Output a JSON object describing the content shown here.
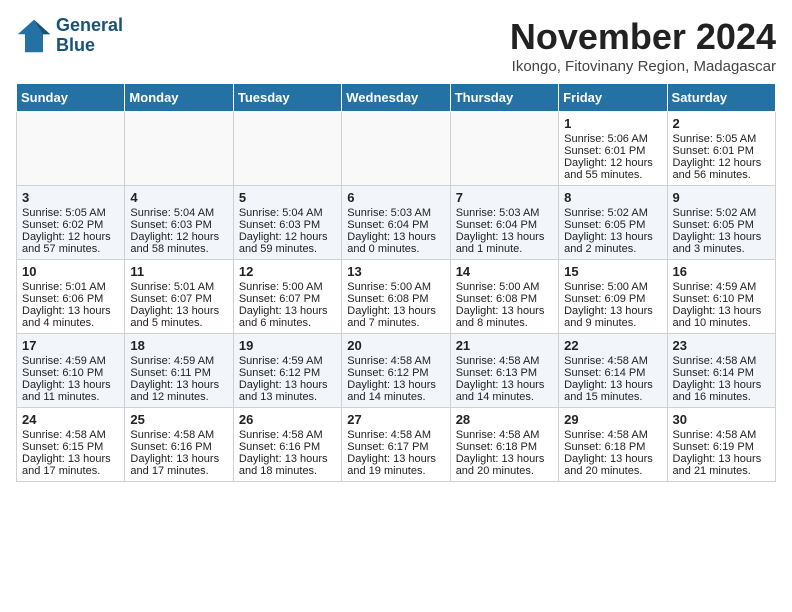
{
  "header": {
    "logo_line1": "General",
    "logo_line2": "Blue",
    "month": "November 2024",
    "location": "Ikongo, Fitovinany Region, Madagascar"
  },
  "weekdays": [
    "Sunday",
    "Monday",
    "Tuesday",
    "Wednesday",
    "Thursday",
    "Friday",
    "Saturday"
  ],
  "weeks": [
    [
      {
        "day": "",
        "sunrise": "",
        "sunset": "",
        "daylight": ""
      },
      {
        "day": "",
        "sunrise": "",
        "sunset": "",
        "daylight": ""
      },
      {
        "day": "",
        "sunrise": "",
        "sunset": "",
        "daylight": ""
      },
      {
        "day": "",
        "sunrise": "",
        "sunset": "",
        "daylight": ""
      },
      {
        "day": "",
        "sunrise": "",
        "sunset": "",
        "daylight": ""
      },
      {
        "day": "1",
        "sunrise": "Sunrise: 5:06 AM",
        "sunset": "Sunset: 6:01 PM",
        "daylight": "Daylight: 12 hours and 55 minutes."
      },
      {
        "day": "2",
        "sunrise": "Sunrise: 5:05 AM",
        "sunset": "Sunset: 6:01 PM",
        "daylight": "Daylight: 12 hours and 56 minutes."
      }
    ],
    [
      {
        "day": "3",
        "sunrise": "Sunrise: 5:05 AM",
        "sunset": "Sunset: 6:02 PM",
        "daylight": "Daylight: 12 hours and 57 minutes."
      },
      {
        "day": "4",
        "sunrise": "Sunrise: 5:04 AM",
        "sunset": "Sunset: 6:03 PM",
        "daylight": "Daylight: 12 hours and 58 minutes."
      },
      {
        "day": "5",
        "sunrise": "Sunrise: 5:04 AM",
        "sunset": "Sunset: 6:03 PM",
        "daylight": "Daylight: 12 hours and 59 minutes."
      },
      {
        "day": "6",
        "sunrise": "Sunrise: 5:03 AM",
        "sunset": "Sunset: 6:04 PM",
        "daylight": "Daylight: 13 hours and 0 minutes."
      },
      {
        "day": "7",
        "sunrise": "Sunrise: 5:03 AM",
        "sunset": "Sunset: 6:04 PM",
        "daylight": "Daylight: 13 hours and 1 minute."
      },
      {
        "day": "8",
        "sunrise": "Sunrise: 5:02 AM",
        "sunset": "Sunset: 6:05 PM",
        "daylight": "Daylight: 13 hours and 2 minutes."
      },
      {
        "day": "9",
        "sunrise": "Sunrise: 5:02 AM",
        "sunset": "Sunset: 6:05 PM",
        "daylight": "Daylight: 13 hours and 3 minutes."
      }
    ],
    [
      {
        "day": "10",
        "sunrise": "Sunrise: 5:01 AM",
        "sunset": "Sunset: 6:06 PM",
        "daylight": "Daylight: 13 hours and 4 minutes."
      },
      {
        "day": "11",
        "sunrise": "Sunrise: 5:01 AM",
        "sunset": "Sunset: 6:07 PM",
        "daylight": "Daylight: 13 hours and 5 minutes."
      },
      {
        "day": "12",
        "sunrise": "Sunrise: 5:00 AM",
        "sunset": "Sunset: 6:07 PM",
        "daylight": "Daylight: 13 hours and 6 minutes."
      },
      {
        "day": "13",
        "sunrise": "Sunrise: 5:00 AM",
        "sunset": "Sunset: 6:08 PM",
        "daylight": "Daylight: 13 hours and 7 minutes."
      },
      {
        "day": "14",
        "sunrise": "Sunrise: 5:00 AM",
        "sunset": "Sunset: 6:08 PM",
        "daylight": "Daylight: 13 hours and 8 minutes."
      },
      {
        "day": "15",
        "sunrise": "Sunrise: 5:00 AM",
        "sunset": "Sunset: 6:09 PM",
        "daylight": "Daylight: 13 hours and 9 minutes."
      },
      {
        "day": "16",
        "sunrise": "Sunrise: 4:59 AM",
        "sunset": "Sunset: 6:10 PM",
        "daylight": "Daylight: 13 hours and 10 minutes."
      }
    ],
    [
      {
        "day": "17",
        "sunrise": "Sunrise: 4:59 AM",
        "sunset": "Sunset: 6:10 PM",
        "daylight": "Daylight: 13 hours and 11 minutes."
      },
      {
        "day": "18",
        "sunrise": "Sunrise: 4:59 AM",
        "sunset": "Sunset: 6:11 PM",
        "daylight": "Daylight: 13 hours and 12 minutes."
      },
      {
        "day": "19",
        "sunrise": "Sunrise: 4:59 AM",
        "sunset": "Sunset: 6:12 PM",
        "daylight": "Daylight: 13 hours and 13 minutes."
      },
      {
        "day": "20",
        "sunrise": "Sunrise: 4:58 AM",
        "sunset": "Sunset: 6:12 PM",
        "daylight": "Daylight: 13 hours and 14 minutes."
      },
      {
        "day": "21",
        "sunrise": "Sunrise: 4:58 AM",
        "sunset": "Sunset: 6:13 PM",
        "daylight": "Daylight: 13 hours and 14 minutes."
      },
      {
        "day": "22",
        "sunrise": "Sunrise: 4:58 AM",
        "sunset": "Sunset: 6:14 PM",
        "daylight": "Daylight: 13 hours and 15 minutes."
      },
      {
        "day": "23",
        "sunrise": "Sunrise: 4:58 AM",
        "sunset": "Sunset: 6:14 PM",
        "daylight": "Daylight: 13 hours and 16 minutes."
      }
    ],
    [
      {
        "day": "24",
        "sunrise": "Sunrise: 4:58 AM",
        "sunset": "Sunset: 6:15 PM",
        "daylight": "Daylight: 13 hours and 17 minutes."
      },
      {
        "day": "25",
        "sunrise": "Sunrise: 4:58 AM",
        "sunset": "Sunset: 6:16 PM",
        "daylight": "Daylight: 13 hours and 17 minutes."
      },
      {
        "day": "26",
        "sunrise": "Sunrise: 4:58 AM",
        "sunset": "Sunset: 6:16 PM",
        "daylight": "Daylight: 13 hours and 18 minutes."
      },
      {
        "day": "27",
        "sunrise": "Sunrise: 4:58 AM",
        "sunset": "Sunset: 6:17 PM",
        "daylight": "Daylight: 13 hours and 19 minutes."
      },
      {
        "day": "28",
        "sunrise": "Sunrise: 4:58 AM",
        "sunset": "Sunset: 6:18 PM",
        "daylight": "Daylight: 13 hours and 20 minutes."
      },
      {
        "day": "29",
        "sunrise": "Sunrise: 4:58 AM",
        "sunset": "Sunset: 6:18 PM",
        "daylight": "Daylight: 13 hours and 20 minutes."
      },
      {
        "day": "30",
        "sunrise": "Sunrise: 4:58 AM",
        "sunset": "Sunset: 6:19 PM",
        "daylight": "Daylight: 13 hours and 21 minutes."
      }
    ]
  ]
}
